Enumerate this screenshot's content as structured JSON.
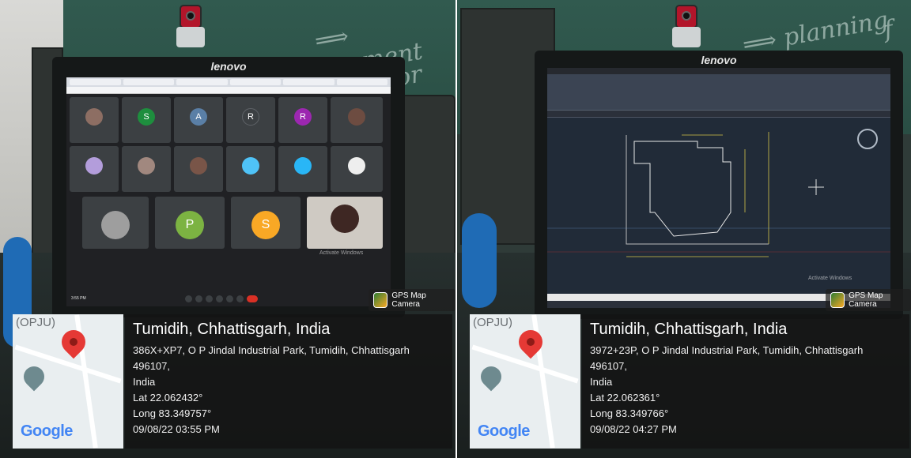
{
  "photos": [
    {
      "monitor_brand": "lenovo",
      "gps_app_label": "GPS Map Camera",
      "map_area_label": "(OPJU)",
      "map_logo": "Google",
      "city": "Tumidih, Chhattisgarh, India",
      "address_line1": "386X+XP7, O P Jindal Industrial Park, Tumidih, Chhattisgarh 496107,",
      "address_line2": "India",
      "lat": "Lat 22.062432°",
      "long": "Long 83.349757°",
      "datetime": "09/08/22 03:55 PM",
      "screen_watermark": "Activate Windows"
    },
    {
      "monitor_brand": "lenovo",
      "gps_app_label": "GPS Map Camera",
      "map_area_label": "(OPJU)",
      "map_logo": "Google",
      "city": "Tumidih, Chhattisgarh, India",
      "address_line1": "3972+23P, O P Jindal Industrial Park, Tumidih, Chhattisgarh 496107,",
      "address_line2": "India",
      "lat": "Lat 22.062361°",
      "long": "Long 83.349766°",
      "datetime": "09/08/22 04:27 PM",
      "screen_watermark": "Activate Windows"
    }
  ],
  "meeting": {
    "time": "3:55 PM",
    "tiles": [
      {
        "initial": "",
        "color": "#5f6368"
      },
      {
        "initial": "S",
        "color": "#1e8e3e"
      },
      {
        "initial": "A",
        "color": "#5a7fa6"
      },
      {
        "initial": "R",
        "color": "#3c4043"
      },
      {
        "initial": "R",
        "color": "#9c27b0"
      },
      {
        "initial": "",
        "color": "#5f6368"
      },
      {
        "initial": "",
        "color": "#5f6368"
      },
      {
        "initial": "",
        "color": "#5f6368"
      },
      {
        "initial": "",
        "color": "#5f6368"
      },
      {
        "initial": "",
        "color": "#5f6368"
      },
      {
        "initial": "",
        "color": "#5f6368"
      },
      {
        "initial": "",
        "color": "#5f6368"
      },
      {
        "initial": "",
        "color": "#5f6368"
      },
      {
        "initial": "P",
        "color": "#7cb342"
      },
      {
        "initial": "S",
        "color": "#f9a825"
      }
    ]
  },
  "icons": {
    "gps_app": "gps-map-camera-icon",
    "pin": "map-pin-icon",
    "campus": "education-cap-icon",
    "webcam": "webcam-icon"
  },
  "colors": {
    "overlay": "#141414",
    "pin": "#e53935",
    "board": "#315a4f"
  }
}
